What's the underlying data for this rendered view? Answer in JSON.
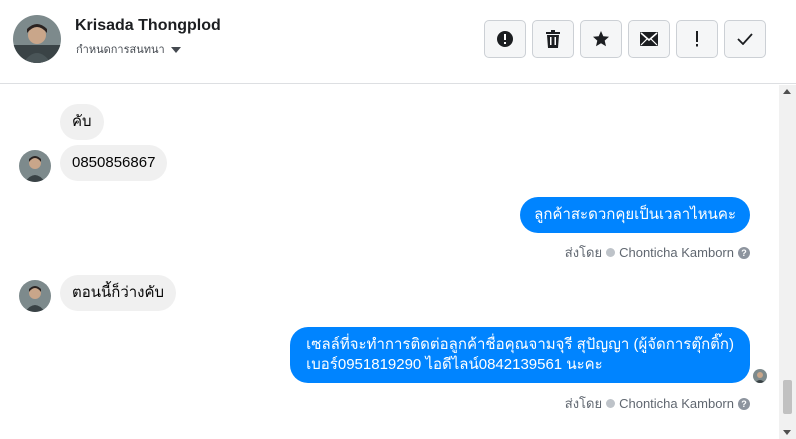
{
  "contact": {
    "name": "Krisada Thongplod",
    "subtitle": "กำหนดการสนทนา"
  },
  "actions": [
    {
      "icon": "alert-circle-icon",
      "name": "report-button"
    },
    {
      "icon": "trash-icon",
      "name": "delete-button"
    },
    {
      "icon": "star-icon",
      "name": "star-button"
    },
    {
      "icon": "envelope-icon",
      "name": "mark-unread-button"
    },
    {
      "icon": "exclamation-icon",
      "name": "follow-up-button"
    },
    {
      "icon": "checkmark-icon",
      "name": "mark-done-button"
    }
  ],
  "messages": [
    {
      "from": "contact",
      "text": "คับ"
    },
    {
      "from": "contact",
      "text": "0850856867"
    },
    {
      "from": "page",
      "text": "ลูกค้าสะดวกคุยเป็นเวลาไหนคะ",
      "sent_by_label": "ส่งโดย",
      "sent_by_name": "Chonticha Kamborn"
    },
    {
      "from": "contact",
      "text": "ตอนนี้ก็ว่างคับ"
    },
    {
      "from": "page",
      "line1": "เซลล์ที่จะทำการติดต่อลูกค้าชื่อคุณจามจุรี สุปัญญา (ผู้จัดการตุ๊กติ๊ก)",
      "line2": "เบอร์0951819290 ไอดีไลน์0842139561 นะคะ",
      "sent_by_label": "ส่งโดย",
      "sent_by_name": "Chonticha Kamborn"
    }
  ],
  "help_glyph": "?",
  "colors": {
    "outgoing_bubble": "#0084ff",
    "incoming_bubble": "#f0f0f0",
    "border": "#dddfe2"
  }
}
